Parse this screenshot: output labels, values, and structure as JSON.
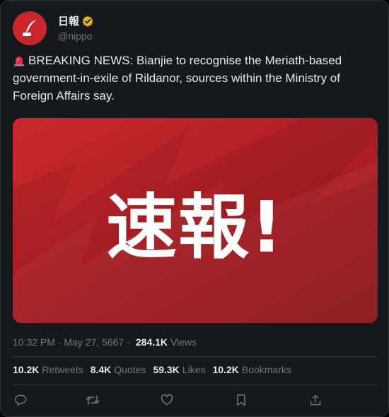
{
  "account": {
    "display_name": "日報",
    "handle": "@nippo",
    "verified": true,
    "avatar_color": "#c8262a"
  },
  "post": {
    "text": "BREAKING NEWS: Bianjie to recognise the Meriath-based government-in-exile of Rildanor, sources within the Ministry of Foreign Affairs say.",
    "media_banner_text": "速報!",
    "timestamp": "10:32 PM · May 27, 5667",
    "views_count": "284.1K",
    "views_label": "Views"
  },
  "stats": {
    "retweets": {
      "count": "10.2K",
      "label": "Retweets"
    },
    "quotes": {
      "count": "8.4K",
      "label": "Quotes"
    },
    "likes": {
      "count": "59.3K",
      "label": "Likes"
    },
    "bookmarks": {
      "count": "10.2K",
      "label": "Bookmarks"
    }
  },
  "actions": [
    "reply-icon",
    "retweet-icon",
    "like-icon",
    "bookmark-icon",
    "share-icon"
  ],
  "colors": {
    "accent_red": "#c8262a",
    "verified_gold": "#e2b719"
  }
}
